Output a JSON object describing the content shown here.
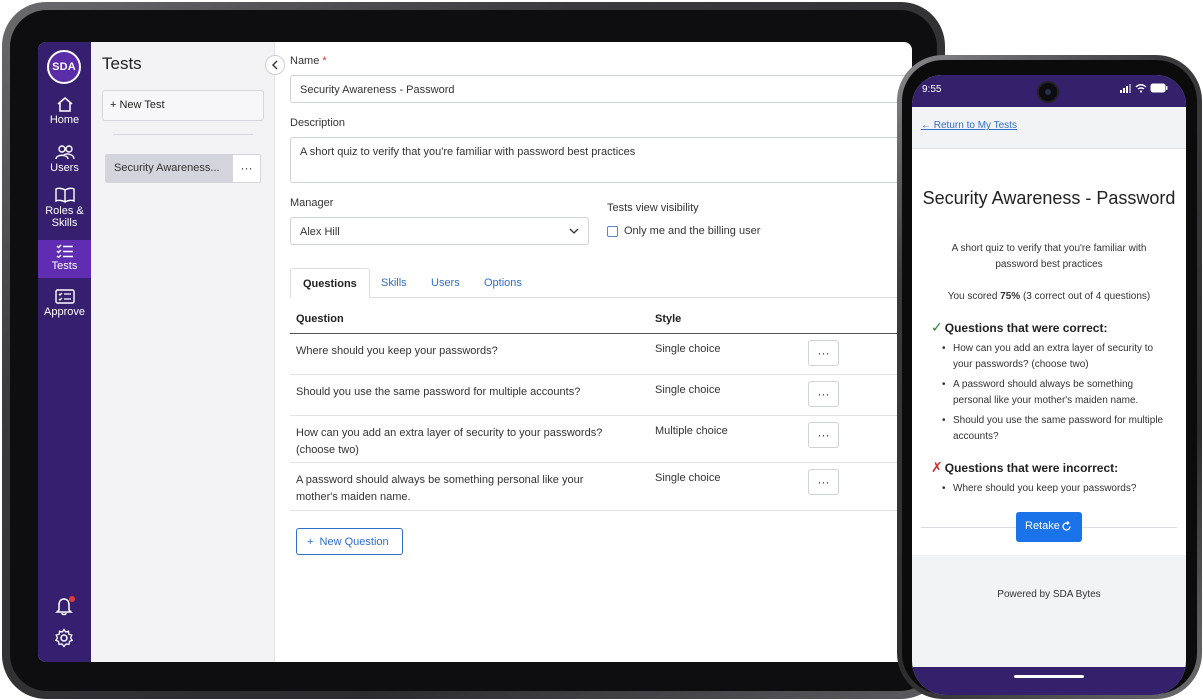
{
  "app": {
    "logo_text": "SDA"
  },
  "sidebar": {
    "items": [
      {
        "label": "Home",
        "icon": "home-icon"
      },
      {
        "label": "Users",
        "icon": "users-icon"
      },
      {
        "label": "Roles &",
        "label2": "Skills",
        "icon": "book-icon"
      },
      {
        "label": "Tests",
        "icon": "list-check-icon",
        "active": true
      },
      {
        "label": "Approve",
        "icon": "approve-card-icon"
      }
    ],
    "bottom_icons": [
      "bell-icon",
      "gear-icon"
    ]
  },
  "tests_panel": {
    "title": "Tests",
    "new_test_label": "New Test",
    "items": [
      {
        "label": "Security Awareness...",
        "more": "···"
      }
    ]
  },
  "form": {
    "name_label": "Name",
    "required_mark": "*",
    "name_value": "Security Awareness - Password",
    "description_label": "Description",
    "description_value": "A short quiz to verify that you're familiar with password best practices",
    "manager_label": "Manager",
    "manager_value": "Alex Hill",
    "visibility_label": "Tests view visibility",
    "visibility_option": "Only me and the billing user",
    "visibility_checked": false
  },
  "tabs": [
    {
      "label": "Questions",
      "active": true
    },
    {
      "label": "Skills"
    },
    {
      "label": "Users"
    },
    {
      "label": "Options"
    }
  ],
  "table": {
    "headers": [
      "Question",
      "Style"
    ],
    "rows": [
      {
        "question": "Where should you keep your passwords?",
        "style": "Single choice",
        "more": "···"
      },
      {
        "question": "Should you use the same password for multiple accounts?",
        "style": "Single choice",
        "more": "···"
      },
      {
        "question": "How can you add an extra layer of security to your passwords? (choose two)",
        "style": "Multiple choice",
        "more": "···"
      },
      {
        "question": "A password should always be something personal like your mother's maiden name.",
        "style": "Single choice",
        "more": "···"
      }
    ]
  },
  "new_question_label": "New Question",
  "phone": {
    "status_time": "9:55",
    "return_link": "← Return to My Tests",
    "title": "Security Awareness - Password",
    "description": "A short quiz to verify that you're familiar with password best practices",
    "score_prefix": "You scored ",
    "score_value": "75%",
    "score_suffix": " (3 correct out of 4 questions)",
    "correct_heading": "Questions that were correct:",
    "correct_mark": "✓",
    "correct_items": [
      "How can you add an extra layer of security to your passwords? (choose two)",
      "A password should always be something personal like your mother's maiden name.",
      "Should you use the same password for multiple accounts?"
    ],
    "incorrect_heading": "Questions that were incorrect:",
    "incorrect_mark": "✗",
    "incorrect_items": [
      "Where should you keep your passwords?"
    ],
    "retake_label": "Retake",
    "powered_by": "Powered by SDA Bytes"
  },
  "colors": {
    "sidebar_bg": "#361f6e",
    "sidebar_active": "#5f2cb2",
    "link_blue": "#2f6ec9",
    "button_blue": "#1a73e8",
    "correct_green": "#2e7d32",
    "incorrect_red": "#d32f2f"
  }
}
